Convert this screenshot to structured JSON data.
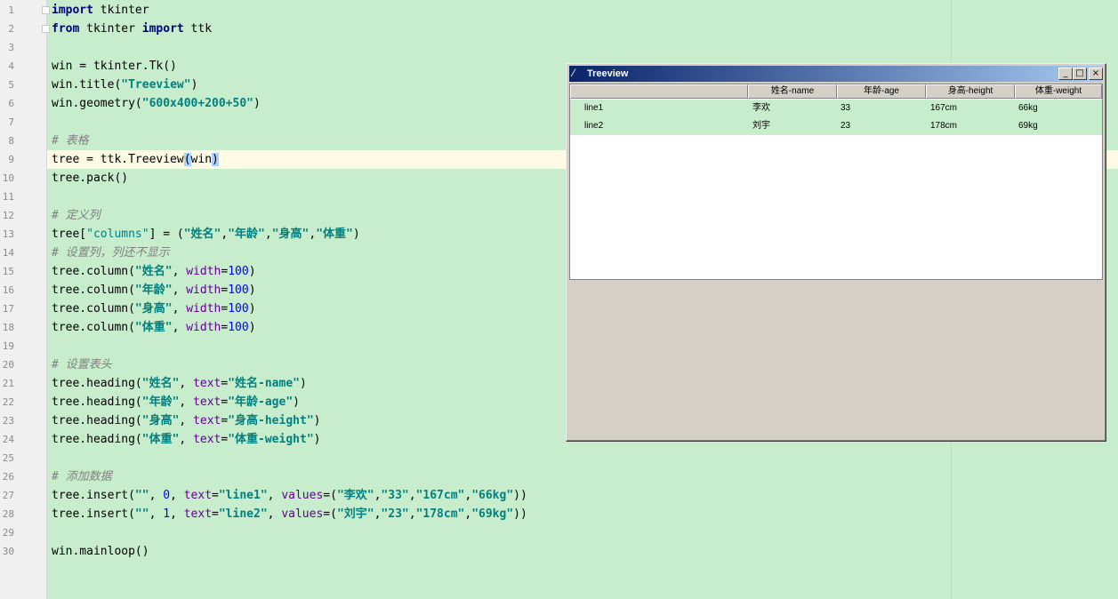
{
  "editor": {
    "lines": [
      {
        "n": "1",
        "segs": [
          {
            "t": "import",
            "c": "kw"
          },
          {
            "t": " tkinter",
            "c": ""
          }
        ]
      },
      {
        "n": "2",
        "segs": [
          {
            "t": "from",
            "c": "kw"
          },
          {
            "t": " tkinter ",
            "c": ""
          },
          {
            "t": "import",
            "c": "kw"
          },
          {
            "t": " ttk",
            "c": ""
          }
        ]
      },
      {
        "n": "3",
        "segs": []
      },
      {
        "n": "4",
        "segs": [
          {
            "t": "win = tkinter.Tk()",
            "c": ""
          }
        ]
      },
      {
        "n": "5",
        "segs": [
          {
            "t": "win.title(",
            "c": ""
          },
          {
            "t": "\"Treeview\"",
            "c": "str"
          },
          {
            "t": ")",
            "c": ""
          }
        ]
      },
      {
        "n": "6",
        "segs": [
          {
            "t": "win.geometry(",
            "c": ""
          },
          {
            "t": "\"600x400+200+50\"",
            "c": "str"
          },
          {
            "t": ")",
            "c": ""
          }
        ]
      },
      {
        "n": "7",
        "segs": []
      },
      {
        "n": "8",
        "segs": [
          {
            "t": "# 表格",
            "c": "comment"
          }
        ]
      },
      {
        "n": "9",
        "segs": [
          {
            "t": "tree = ttk.Treeview",
            "c": ""
          },
          {
            "t": "(",
            "c": "hl"
          },
          {
            "t": "win",
            "c": ""
          },
          {
            "t": ")",
            "c": "hl"
          }
        ]
      },
      {
        "n": "10",
        "segs": [
          {
            "t": "tree.pack()",
            "c": ""
          }
        ]
      },
      {
        "n": "11",
        "segs": []
      },
      {
        "n": "12",
        "segs": [
          {
            "t": "# 定义列",
            "c": "comment"
          }
        ]
      },
      {
        "n": "13",
        "segs": [
          {
            "t": "tree[",
            "c": ""
          },
          {
            "t": "\"columns\"",
            "c": "strn"
          },
          {
            "t": "] = (",
            "c": ""
          },
          {
            "t": "\"姓名\"",
            "c": "str"
          },
          {
            "t": ",",
            "c": ""
          },
          {
            "t": "\"年龄\"",
            "c": "str"
          },
          {
            "t": ",",
            "c": ""
          },
          {
            "t": "\"身高\"",
            "c": "str"
          },
          {
            "t": ",",
            "c": ""
          },
          {
            "t": "\"体重\"",
            "c": "str"
          },
          {
            "t": ")",
            "c": ""
          }
        ]
      },
      {
        "n": "14",
        "segs": [
          {
            "t": "# 设置列，列还不显示",
            "c": "comment"
          }
        ]
      },
      {
        "n": "15",
        "segs": [
          {
            "t": "tree.column(",
            "c": ""
          },
          {
            "t": "\"姓名\"",
            "c": "str"
          },
          {
            "t": ", ",
            "c": ""
          },
          {
            "t": "width",
            "c": "param"
          },
          {
            "t": "=",
            "c": ""
          },
          {
            "t": "100",
            "c": "num"
          },
          {
            "t": ")",
            "c": ""
          }
        ]
      },
      {
        "n": "16",
        "segs": [
          {
            "t": "tree.column(",
            "c": ""
          },
          {
            "t": "\"年龄\"",
            "c": "str"
          },
          {
            "t": ", ",
            "c": ""
          },
          {
            "t": "width",
            "c": "param"
          },
          {
            "t": "=",
            "c": ""
          },
          {
            "t": "100",
            "c": "num"
          },
          {
            "t": ")",
            "c": ""
          }
        ]
      },
      {
        "n": "17",
        "segs": [
          {
            "t": "tree.column(",
            "c": ""
          },
          {
            "t": "\"身高\"",
            "c": "str"
          },
          {
            "t": ", ",
            "c": ""
          },
          {
            "t": "width",
            "c": "param"
          },
          {
            "t": "=",
            "c": ""
          },
          {
            "t": "100",
            "c": "num"
          },
          {
            "t": ")",
            "c": ""
          }
        ]
      },
      {
        "n": "18",
        "segs": [
          {
            "t": "tree.column(",
            "c": ""
          },
          {
            "t": "\"体重\"",
            "c": "str"
          },
          {
            "t": ", ",
            "c": ""
          },
          {
            "t": "width",
            "c": "param"
          },
          {
            "t": "=",
            "c": ""
          },
          {
            "t": "100",
            "c": "num"
          },
          {
            "t": ")",
            "c": ""
          }
        ]
      },
      {
        "n": "19",
        "segs": []
      },
      {
        "n": "20",
        "segs": [
          {
            "t": "# 设置表头",
            "c": "comment"
          }
        ]
      },
      {
        "n": "21",
        "segs": [
          {
            "t": "tree.heading(",
            "c": ""
          },
          {
            "t": "\"姓名\"",
            "c": "str"
          },
          {
            "t": ", ",
            "c": ""
          },
          {
            "t": "text",
            "c": "param"
          },
          {
            "t": "=",
            "c": ""
          },
          {
            "t": "\"姓名-name\"",
            "c": "str"
          },
          {
            "t": ")",
            "c": ""
          }
        ]
      },
      {
        "n": "22",
        "segs": [
          {
            "t": "tree.heading(",
            "c": ""
          },
          {
            "t": "\"年龄\"",
            "c": "str"
          },
          {
            "t": ", ",
            "c": ""
          },
          {
            "t": "text",
            "c": "param"
          },
          {
            "t": "=",
            "c": ""
          },
          {
            "t": "\"年龄-age\"",
            "c": "str"
          },
          {
            "t": ")",
            "c": ""
          }
        ]
      },
      {
        "n": "23",
        "segs": [
          {
            "t": "tree.heading(",
            "c": ""
          },
          {
            "t": "\"身高\"",
            "c": "str"
          },
          {
            "t": ", ",
            "c": ""
          },
          {
            "t": "text",
            "c": "param"
          },
          {
            "t": "=",
            "c": ""
          },
          {
            "t": "\"身高-height\"",
            "c": "str"
          },
          {
            "t": ")",
            "c": ""
          }
        ]
      },
      {
        "n": "24",
        "segs": [
          {
            "t": "tree.heading(",
            "c": ""
          },
          {
            "t": "\"体重\"",
            "c": "str"
          },
          {
            "t": ", ",
            "c": ""
          },
          {
            "t": "text",
            "c": "param"
          },
          {
            "t": "=",
            "c": ""
          },
          {
            "t": "\"体重-weight\"",
            "c": "str"
          },
          {
            "t": ")",
            "c": ""
          }
        ]
      },
      {
        "n": "25",
        "segs": []
      },
      {
        "n": "26",
        "segs": [
          {
            "t": "# 添加数据",
            "c": "comment"
          }
        ]
      },
      {
        "n": "27",
        "segs": [
          {
            "t": "tree.insert(",
            "c": ""
          },
          {
            "t": "\"\"",
            "c": "str"
          },
          {
            "t": ", ",
            "c": ""
          },
          {
            "t": "0",
            "c": "num"
          },
          {
            "t": ", ",
            "c": ""
          },
          {
            "t": "text",
            "c": "param"
          },
          {
            "t": "=",
            "c": ""
          },
          {
            "t": "\"line1\"",
            "c": "str"
          },
          {
            "t": ", ",
            "c": ""
          },
          {
            "t": "values",
            "c": "param"
          },
          {
            "t": "=(",
            "c": ""
          },
          {
            "t": "\"李欢\"",
            "c": "str"
          },
          {
            "t": ",",
            "c": ""
          },
          {
            "t": "\"33\"",
            "c": "str"
          },
          {
            "t": ",",
            "c": ""
          },
          {
            "t": "\"167cm\"",
            "c": "str"
          },
          {
            "t": ",",
            "c": ""
          },
          {
            "t": "\"66kg\"",
            "c": "str"
          },
          {
            "t": "))",
            "c": ""
          }
        ]
      },
      {
        "n": "28",
        "segs": [
          {
            "t": "tree.insert(",
            "c": ""
          },
          {
            "t": "\"\"",
            "c": "str"
          },
          {
            "t": ", ",
            "c": ""
          },
          {
            "t": "1",
            "c": "num"
          },
          {
            "t": ", ",
            "c": ""
          },
          {
            "t": "text",
            "c": "param"
          },
          {
            "t": "=",
            "c": ""
          },
          {
            "t": "\"line2\"",
            "c": "str"
          },
          {
            "t": ", ",
            "c": ""
          },
          {
            "t": "values",
            "c": "param"
          },
          {
            "t": "=(",
            "c": ""
          },
          {
            "t": "\"刘宇\"",
            "c": "str"
          },
          {
            "t": ",",
            "c": ""
          },
          {
            "t": "\"23\"",
            "c": "str"
          },
          {
            "t": ",",
            "c": ""
          },
          {
            "t": "\"178cm\"",
            "c": "str"
          },
          {
            "t": ",",
            "c": ""
          },
          {
            "t": "\"69kg\"",
            "c": "str"
          },
          {
            "t": "))",
            "c": ""
          }
        ]
      },
      {
        "n": "29",
        "segs": []
      },
      {
        "n": "30",
        "segs": [
          {
            "t": "win.mainloop()",
            "c": ""
          }
        ]
      }
    ]
  },
  "tk_window": {
    "title": "Treeview",
    "icon": "feather-icon",
    "minimize_glyph": "_",
    "maximize_glyph": "□",
    "close_glyph": "×",
    "headings": [
      "",
      "姓名-name",
      "年龄-age",
      "身高-height",
      "体重-weight"
    ],
    "rows": [
      [
        "line1",
        "李欢",
        "33",
        "167cm",
        "66kg"
      ],
      [
        "line2",
        "刘宇",
        "23",
        "178cm",
        "69kg"
      ]
    ]
  },
  "colors": {
    "editor_bg": "#c7edcc",
    "titlebar_start": "#0a246a",
    "titlebar_end": "#a6caf0",
    "row_bg": "#c7edcc"
  }
}
